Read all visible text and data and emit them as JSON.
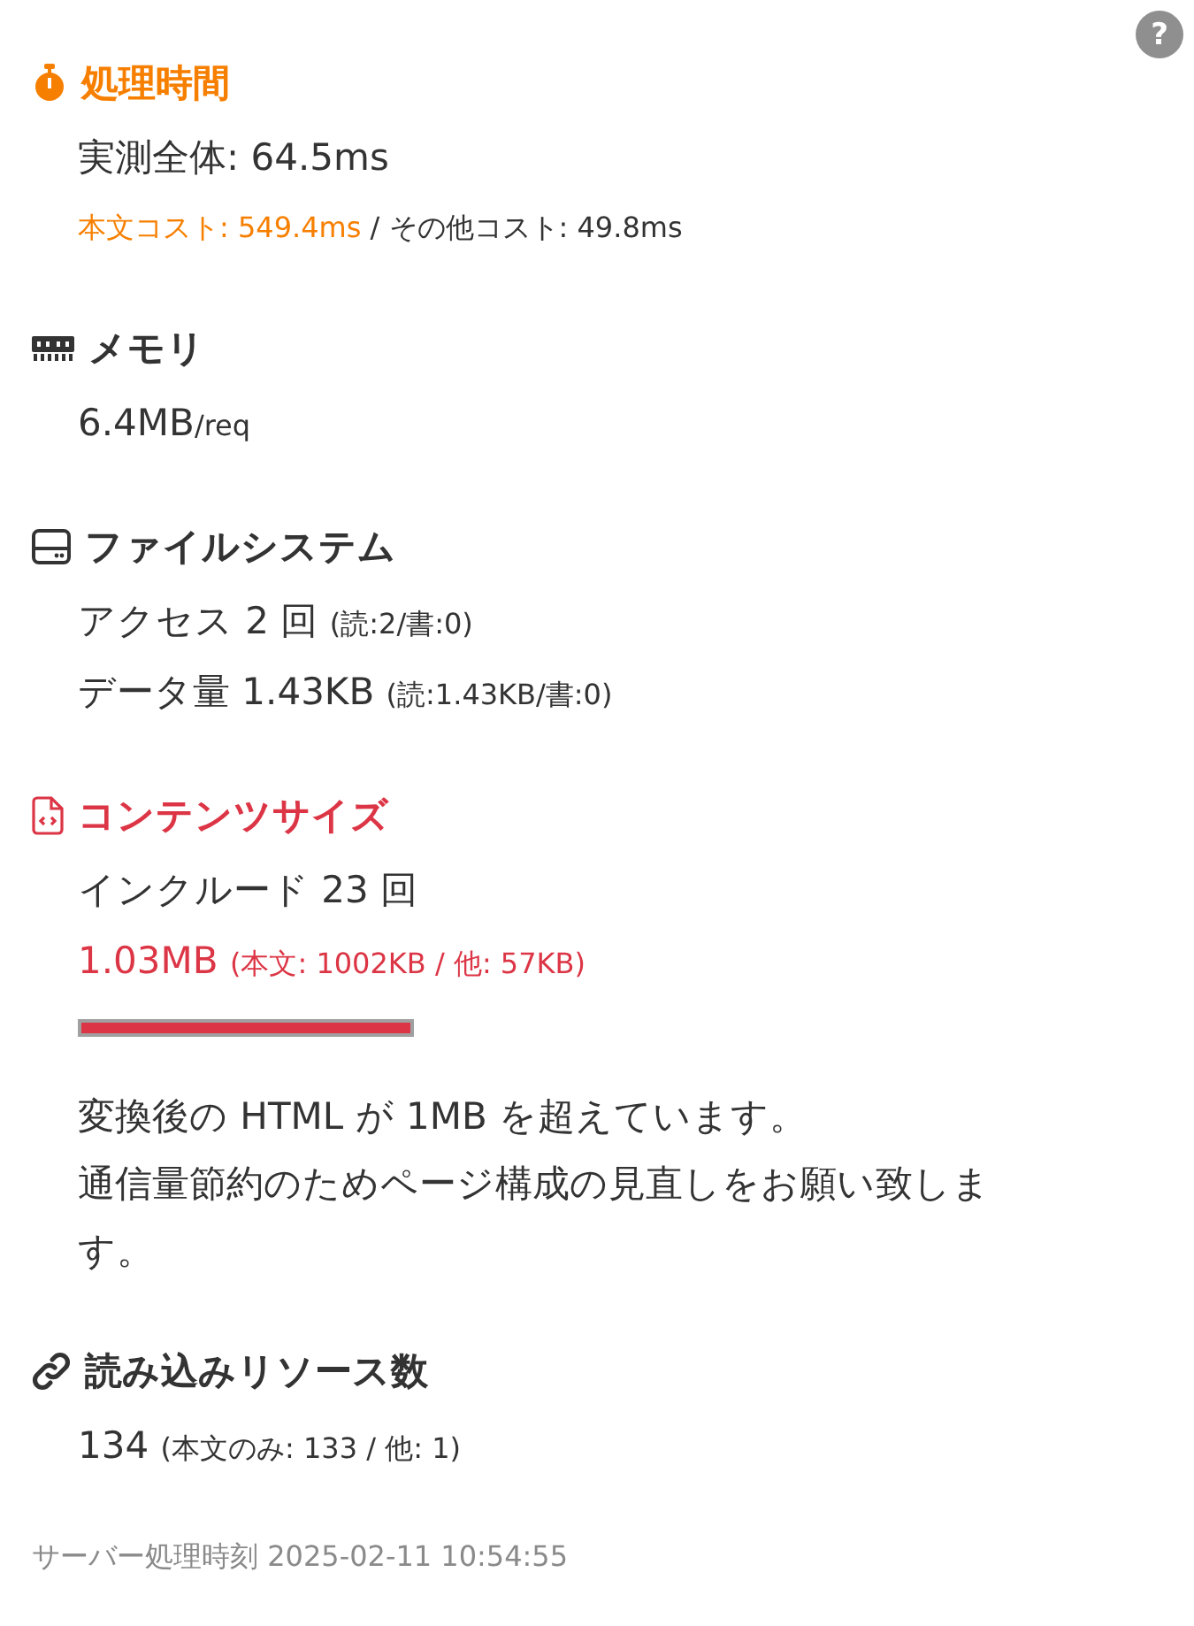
{
  "help_button": "?",
  "sections": [
    {
      "kind": "timing",
      "title": "処理時間",
      "lines": [
        {
          "kind": "stat",
          "main": "実測全体: 64.5ms"
        },
        {
          "kind": "cost",
          "main": "本文コスト: 549.4ms",
          "note": " / その他コスト: 49.8ms"
        }
      ]
    },
    {
      "kind": "memory",
      "title": "メモリ",
      "lines": [
        {
          "kind": "stat",
          "main": "6.4MB",
          "note": "/req"
        }
      ]
    },
    {
      "kind": "filesystem",
      "title": "ファイルシステム",
      "lines": [
        {
          "kind": "stat",
          "main": "アクセス 2 回 ",
          "note": "(読:2/書:0)"
        },
        {
          "kind": "stat",
          "main": "データ量 1.43KB ",
          "note": "(読:1.43KB/書:0)"
        }
      ]
    },
    {
      "kind": "content",
      "title": "コンテンツサイズ",
      "lines": [
        {
          "kind": "stat",
          "main": "インクルード 23 回"
        },
        {
          "kind": "over",
          "main": "1.03MB ",
          "note": "(本文: 1002KB / 他: 57KB)"
        }
      ],
      "meter": {
        "level": 1.0
      },
      "message": [
        "変換後の HTML が 1MB を超えています。",
        "通信量節約のためページ構成の見直しをお願い致します。"
      ]
    },
    {
      "kind": "resources",
      "title": "読み込みリソース数",
      "lines": [
        {
          "kind": "stat",
          "main": "134 ",
          "note": "(本文のみ: 133 / 他: 1)"
        }
      ]
    }
  ],
  "footer": {
    "label": "サーバー処理時刻",
    "value": "2025-02-11 10:54:55"
  }
}
